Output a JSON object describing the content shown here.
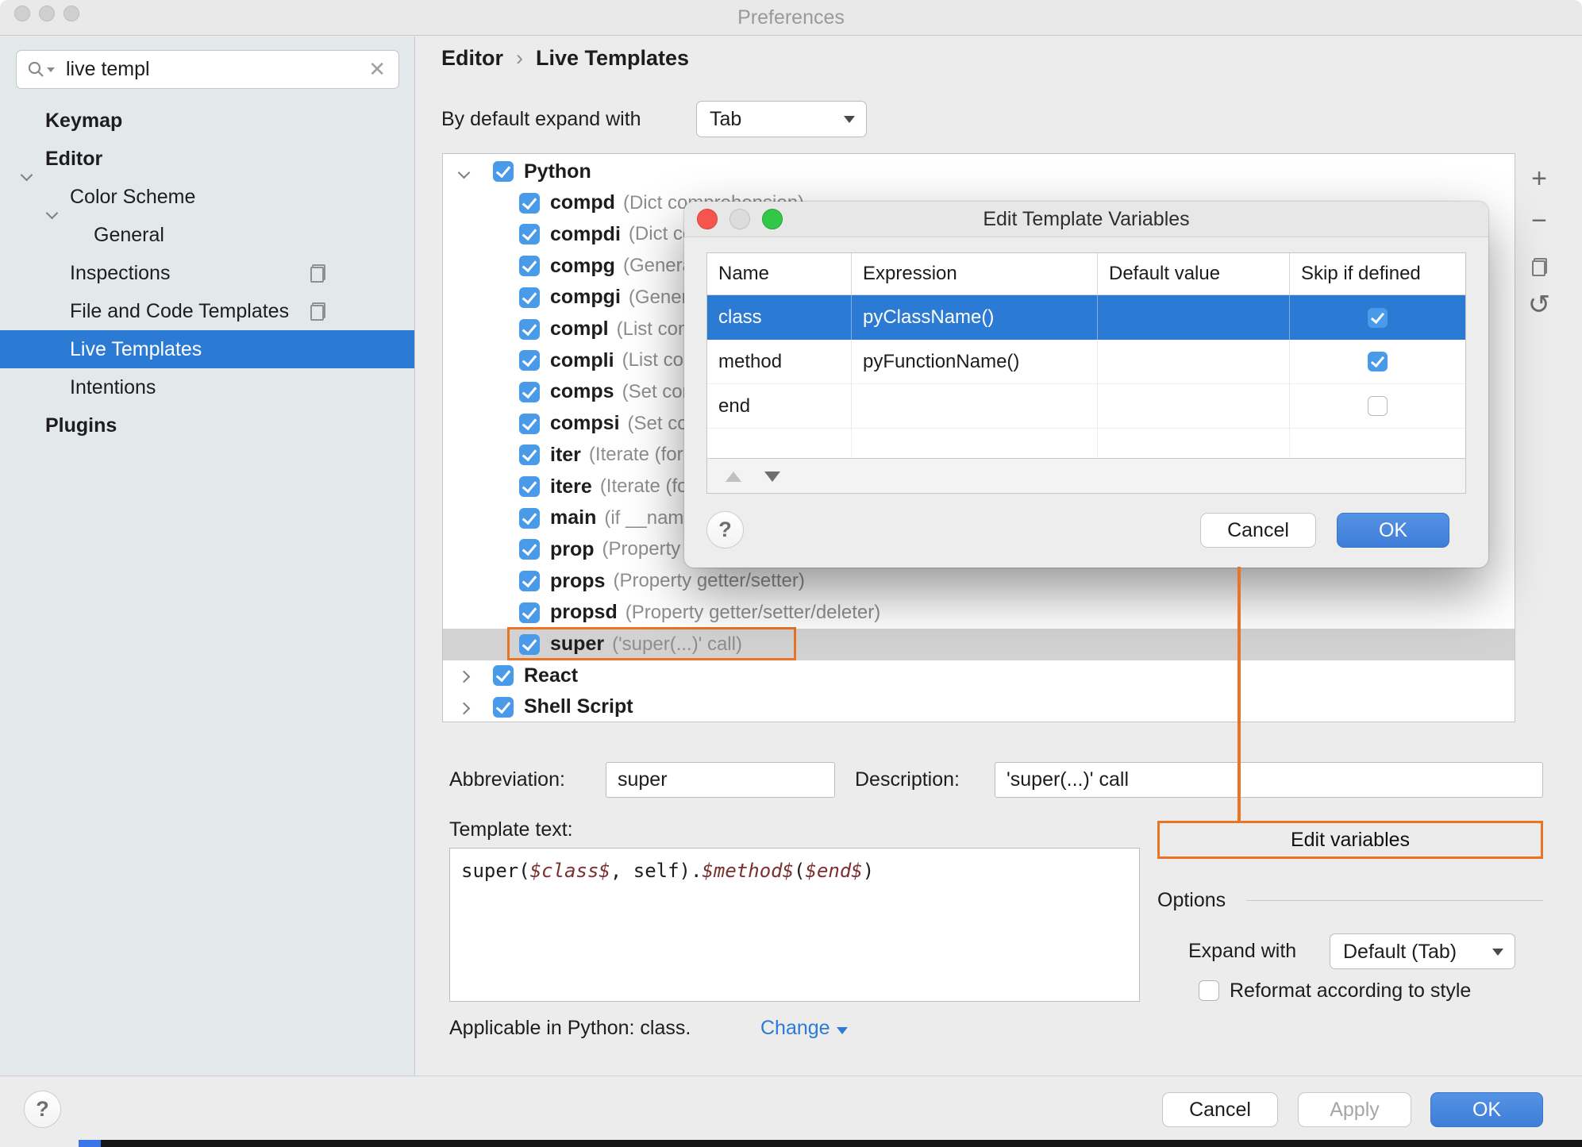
{
  "window": {
    "title": "Preferences"
  },
  "sidebar": {
    "search": {
      "value": "live templ"
    },
    "items": [
      {
        "label": "Keymap",
        "bold": true,
        "indent": 1
      },
      {
        "label": "Editor",
        "bold": true,
        "indent": 1,
        "chevron": "down"
      },
      {
        "label": "Color Scheme",
        "indent": 2,
        "chevron": "down"
      },
      {
        "label": "General",
        "indent": 3
      },
      {
        "label": "Inspections",
        "indent": 2,
        "copy_icon": true
      },
      {
        "label": "File and Code Templates",
        "indent": 2,
        "copy_icon": true
      },
      {
        "label": "Live Templates",
        "indent": 2,
        "selected": true
      },
      {
        "label": "Intentions",
        "indent": 2
      },
      {
        "label": "Plugins",
        "bold": true,
        "indent": 1
      }
    ]
  },
  "header": {
    "breadcrumb": [
      "Editor",
      "Live Templates"
    ],
    "expand_label": "By default expand with",
    "expand_value": "Tab"
  },
  "tree": {
    "rows": [
      {
        "kind": "group",
        "label": "Python",
        "chevron": "down",
        "checked": true
      },
      {
        "kind": "tpl",
        "name": "compd",
        "desc": "(Dict comprehension)",
        "checked": true
      },
      {
        "kind": "tpl",
        "name": "compdi",
        "desc": "(Dict comprehension with if)",
        "checked": true
      },
      {
        "kind": "tpl",
        "name": "compg",
        "desc": "(Generator comprehension)",
        "checked": true
      },
      {
        "kind": "tpl",
        "name": "compgi",
        "desc": "(Generator comprehension with if)",
        "checked": true
      },
      {
        "kind": "tpl",
        "name": "compl",
        "desc": "(List comprehension)",
        "checked": true
      },
      {
        "kind": "tpl",
        "name": "compli",
        "desc": "(List comprehension with if)",
        "checked": true
      },
      {
        "kind": "tpl",
        "name": "comps",
        "desc": "(Set comprehension)",
        "checked": true
      },
      {
        "kind": "tpl",
        "name": "compsi",
        "desc": "(Set comprehension with if)",
        "checked": true
      },
      {
        "kind": "tpl",
        "name": "iter",
        "desc": "(Iterate (for ... in ...))",
        "checked": true
      },
      {
        "kind": "tpl",
        "name": "itere",
        "desc": "(Iterate (for ... in enumerate))",
        "checked": true
      },
      {
        "kind": "tpl",
        "name": "main",
        "desc": "(if __name__ == '__main__')",
        "checked": true
      },
      {
        "kind": "tpl",
        "name": "prop",
        "desc": "(Property getter)",
        "checked": true
      },
      {
        "kind": "tpl",
        "name": "props",
        "desc": "(Property getter/setter)",
        "checked": true
      },
      {
        "kind": "tpl",
        "name": "propsd",
        "desc": "(Property getter/setter/deleter)",
        "checked": true
      },
      {
        "kind": "tpl",
        "name": "super",
        "desc": "('super(...)' call)",
        "checked": true,
        "selected": true,
        "highlighted": true
      },
      {
        "kind": "group",
        "label": "React",
        "chevron": "right",
        "checked": true
      },
      {
        "kind": "group",
        "label": "Shell Script",
        "chevron": "right",
        "checked": true
      }
    ]
  },
  "side_toolbar": {
    "icons": [
      "add",
      "remove",
      "duplicate",
      "revert"
    ]
  },
  "modal": {
    "title": "Edit Template Variables",
    "table": {
      "columns": [
        "Name",
        "Expression",
        "Default value",
        "Skip if defined"
      ],
      "rows": [
        {
          "name": "class",
          "expression": "pyClassName()",
          "default": "",
          "skip": true,
          "selected": true
        },
        {
          "name": "method",
          "expression": "pyFunctionName()",
          "default": "",
          "skip": true
        },
        {
          "name": "end",
          "expression": "",
          "default": "",
          "skip": false
        }
      ]
    },
    "help_label": "?",
    "cancel_label": "Cancel",
    "ok_label": "OK"
  },
  "form": {
    "abbreviation_label": "Abbreviation:",
    "abbreviation_value": "super",
    "description_label": "Description:",
    "description_value": "'super(...)' call",
    "template_label": "Template text:",
    "template_code": [
      {
        "t": "super("
      },
      {
        "t": "$class$",
        "var": true
      },
      {
        "t": ", self)."
      },
      {
        "t": "$method$",
        "var": true
      },
      {
        "t": "("
      },
      {
        "t": "$end$",
        "var": true
      },
      {
        "t": ")"
      }
    ],
    "edit_variables_label": "Edit variables",
    "options_label": "Options",
    "expand_with_label": "Expand with",
    "expand_with_value": "Default (Tab)",
    "reformat_label": "Reformat according to style",
    "applicable_text": "Applicable in Python: class.",
    "change_label": "Change"
  },
  "footer": {
    "help_label": "?",
    "cancel_label": "Cancel",
    "apply_label": "Apply",
    "ok_label": "OK"
  },
  "colors": {
    "accent_blue": "#2b7ad4",
    "checkbox_blue": "#4a9aea",
    "selection_gray": "#d2d2d2",
    "annotation_orange": "#e87424",
    "ok_button_blue": "#3f7ed8",
    "link_blue": "#2b7ad4",
    "template_var_red": "#7c2f2f"
  }
}
